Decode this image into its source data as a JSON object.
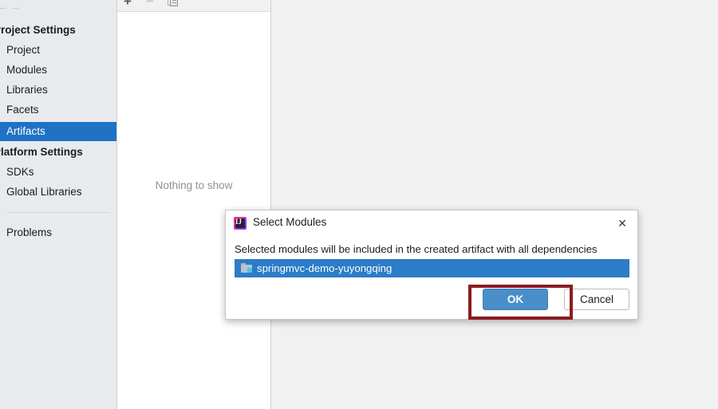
{
  "window": {
    "background_color": "#f1f1f1"
  },
  "sidebar": {
    "background_color": "#e7ebee",
    "selected_color": "#1f72c4",
    "nav": {
      "back_icon": "arrow-left-icon",
      "back_glyph": "←",
      "forward_icon": "arrow-right-icon",
      "forward_glyph": "→"
    },
    "groups": [
      {
        "title": "Project Settings",
        "items": [
          {
            "label": "Project",
            "selected": false
          },
          {
            "label": "Modules",
            "selected": false
          },
          {
            "label": "Libraries",
            "selected": false
          },
          {
            "label": "Facets",
            "selected": false
          },
          {
            "label": "Artifacts",
            "selected": true
          }
        ]
      },
      {
        "title": "Platform Settings",
        "items": [
          {
            "label": "SDKs",
            "selected": false
          },
          {
            "label": "Global Libraries",
            "selected": false
          }
        ]
      }
    ],
    "footer_items": [
      {
        "label": "Problems"
      }
    ]
  },
  "middle_panel": {
    "toolbar": {
      "add_icon": "plus-icon",
      "add_glyph": "+",
      "remove_icon": "minus-icon",
      "remove_glyph": "−",
      "copy_icon": "copy-icon"
    },
    "empty_text": "Nothing to show"
  },
  "dialog": {
    "app_icon": "intellij-idea-icon",
    "app_icon_letters": "IJ",
    "title": "Select Modules",
    "close_icon": "close-icon",
    "close_glyph": "✕",
    "description": "Selected modules will be included in the created artifact with all dependencies",
    "module_list": [
      {
        "icon": "module-icon",
        "label": "springmvc-demo-yuyongqing",
        "selected": true
      }
    ],
    "buttons": {
      "ok_label": "OK",
      "cancel_label": "Cancel",
      "ok_color": "#4a8ec9"
    }
  },
  "annotation": {
    "highlight_name": "ok-button-highlight",
    "color": "#8b1c22"
  }
}
